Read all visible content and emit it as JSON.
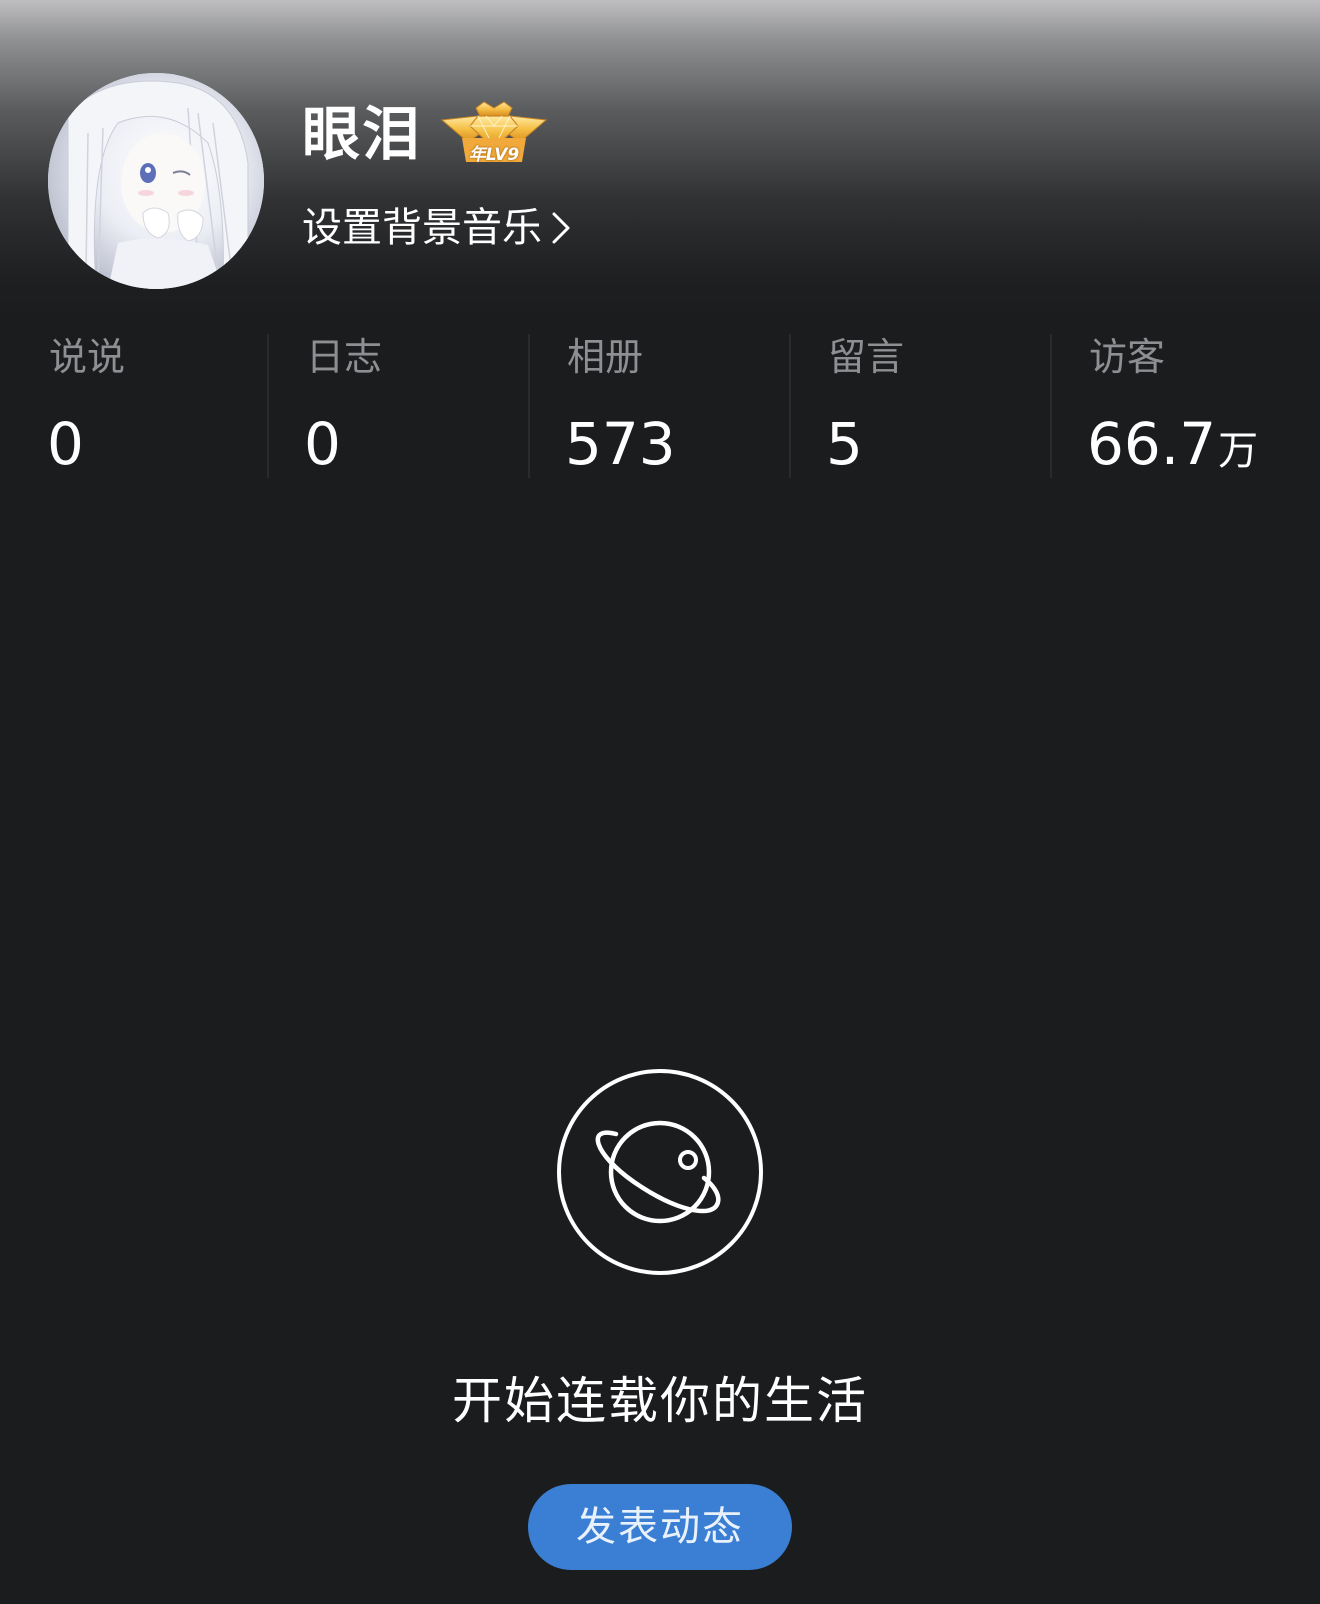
{
  "profile": {
    "username": "眼泪",
    "vip_badge": {
      "text": "年LV9",
      "icon": "crown-badge-icon",
      "color": "#f2b53a"
    },
    "music_link_label": "设置背景音乐",
    "music_link_icon": "chevron-right-icon",
    "avatar_icon": "anime-avatar"
  },
  "stats": [
    {
      "label": "说说",
      "value": "0",
      "unit": ""
    },
    {
      "label": "日志",
      "value": "0",
      "unit": ""
    },
    {
      "label": "相册",
      "value": "573",
      "unit": ""
    },
    {
      "label": "留言",
      "value": "5",
      "unit": ""
    },
    {
      "label": "访客",
      "value": "66.7",
      "unit": "万"
    }
  ],
  "empty_state": {
    "icon": "planet-icon",
    "message": "开始连载你的生活",
    "button_label": "发表动态",
    "button_color": "#3a7fd4"
  },
  "colors": {
    "background": "#1b1c1e",
    "stat_label": "#8e8f93",
    "text": "#ffffff"
  }
}
